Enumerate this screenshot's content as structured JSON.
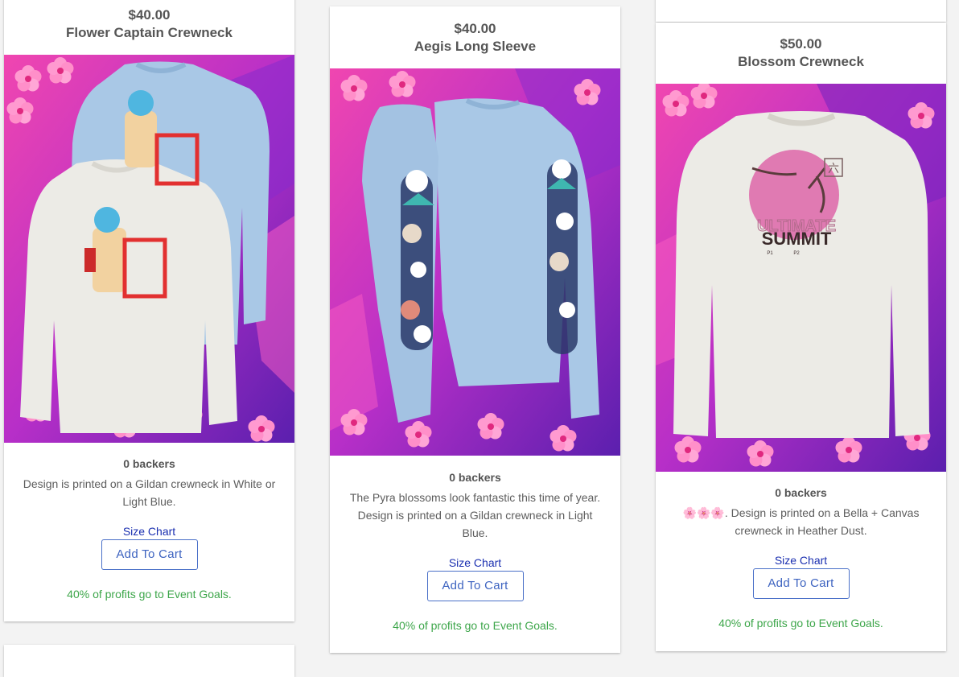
{
  "products": [
    {
      "price": "$40.00",
      "name": "Flower Captain Crewneck",
      "backers": "0 backers",
      "description": "Design is printed on a Gildan crewneck in White or Light Blue.",
      "size_chart": "Size Chart",
      "button": "Add To Cart",
      "goal": "40% of profits go to Event Goals."
    },
    {
      "price": "$40.00",
      "name": "Aegis Long Sleeve",
      "backers": "0 backers",
      "description": "The Pyra blossoms look fantastic this time of year. Design is printed on a Gildan crewneck in Light Blue.",
      "size_chart": "Size Chart",
      "button": "Add To Cart",
      "goal": "40% of profits go to Event Goals."
    },
    {
      "price": "$50.00",
      "name": "Blossom Crewneck",
      "backers": "0 backers",
      "description_emoji": "🌸🌸🌸",
      "description": ". Design is printed on a Bella + Canvas crewneck in Heather Dust.",
      "size_chart": "Size Chart",
      "button": "Add To Cart",
      "goal": "40% of profits go to Event Goals.",
      "print_text_top": "ULTIMATE",
      "print_text_main": "SUMMIT",
      "print_text_small_1": "P1",
      "print_text_small_2": "P2",
      "print_glyph": "六"
    }
  ],
  "colors": {
    "accent_link": "#1a2fb0",
    "button_border": "#4a70c8",
    "goal_green": "#3da64a",
    "bg_pink": "#e2379a",
    "bg_purple": "#6a1fb0",
    "shirt_blue": "#a9c8e6",
    "shirt_white": "#ecebe6"
  }
}
